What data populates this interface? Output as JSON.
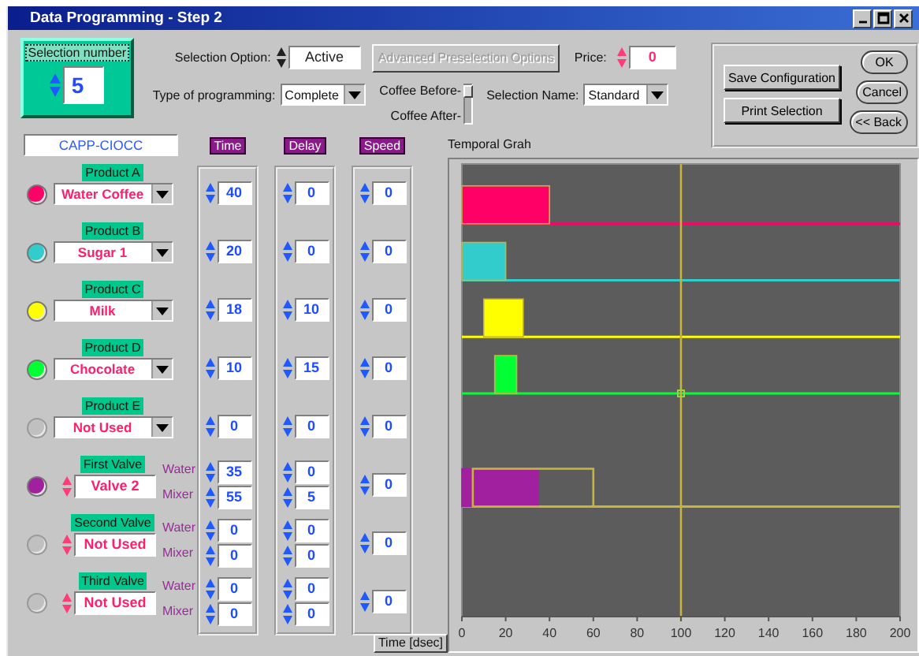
{
  "window": {
    "title": "Data Programming - Step 2"
  },
  "selection_number": {
    "label": "Selection number",
    "value": "5"
  },
  "selection_option": {
    "label": "Selection Option:",
    "value": "Active"
  },
  "advanced_button": {
    "label": "Advanced Preselection Options",
    "disabled": true
  },
  "price": {
    "label": "Price:",
    "value": "0"
  },
  "type_of_programming": {
    "label": "Type of programming:",
    "value": "Complete"
  },
  "coffee_order": {
    "before_label": "Coffee Before-",
    "after_label": "Coffee After-",
    "level": 1
  },
  "selection_name": {
    "label": "Selection Name:",
    "value": "Standard"
  },
  "actions": [
    "Save Configuration",
    "Print Selection"
  ],
  "dialog_buttons": [
    "OK",
    "Cancel",
    "<< Back"
  ],
  "machine_name": "CAPP-CIOCC",
  "column_headers": [
    "Time",
    "Delay",
    "Speed"
  ],
  "rows": [
    {
      "kind": "product",
      "label": "Product A",
      "value": "Water Coffee",
      "on": true,
      "color": "#ff0066",
      "time": "40",
      "delay": "0",
      "speed": "0"
    },
    {
      "kind": "product",
      "label": "Product B",
      "value": "Sugar 1",
      "on": true,
      "color": "#33cccc",
      "time": "20",
      "delay": "0",
      "speed": "0"
    },
    {
      "kind": "product",
      "label": "Product C",
      "value": "Milk",
      "on": true,
      "color": "#ffff00",
      "time": "18",
      "delay": "10",
      "speed": "0"
    },
    {
      "kind": "product",
      "label": "Product D",
      "value": "Chocolate",
      "on": true,
      "color": "#00ff33",
      "time": "10",
      "delay": "15",
      "speed": "0"
    },
    {
      "kind": "product",
      "label": "Product E",
      "value": "Not Used",
      "on": false,
      "time": "0",
      "delay": "0",
      "speed": "0"
    },
    {
      "kind": "valve",
      "label": "First Valve",
      "value": "Valve 2",
      "on": true,
      "color": "#a020a0",
      "lines": [
        {
          "label": "Water",
          "time": "35",
          "delay": "0"
        },
        {
          "label": "Mixer",
          "time": "55",
          "delay": "5"
        }
      ],
      "speed": "0"
    },
    {
      "kind": "valve",
      "label": "Second Valve",
      "value": "Not Used",
      "on": false,
      "lines": [
        {
          "label": "Water",
          "time": "0",
          "delay": "0"
        },
        {
          "label": "Mixer",
          "time": "0",
          "delay": "0"
        }
      ],
      "speed": "0"
    },
    {
      "kind": "valve",
      "label": "Third Valve",
      "value": "Not Used",
      "on": false,
      "lines": [
        {
          "label": "Water",
          "time": "0",
          "delay": "0"
        },
        {
          "label": "Mixer",
          "time": "0",
          "delay": "0"
        }
      ],
      "speed": "0"
    }
  ],
  "time_unit_label": "Time [dsec]",
  "graph": {
    "title": "Temporal Grah",
    "ticks": [
      "0",
      "20",
      "40",
      "60",
      "80",
      "100",
      "120",
      "140",
      "160",
      "180",
      "200"
    ]
  }
}
